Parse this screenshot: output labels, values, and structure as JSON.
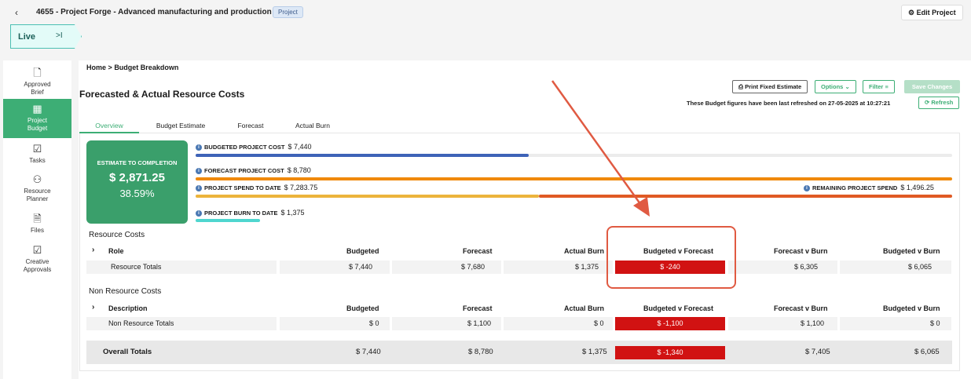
{
  "header": {
    "title": "4655 - Project Forge - Advanced manufacturing and production",
    "badge": "Project",
    "edit_button": "Edit Project",
    "live_label": "Live",
    "live_icon": ">I"
  },
  "sidebar": {
    "items": [
      {
        "label1": "Approved",
        "label2": "Brief",
        "icon": "document-icon",
        "active": false
      },
      {
        "label1": "Project",
        "label2": "Budget",
        "icon": "calculator-icon",
        "active": true
      },
      {
        "label1": "Tasks",
        "label2": "",
        "icon": "calendar-check-icon",
        "active": false
      },
      {
        "label1": "Resource",
        "label2": "Planner",
        "icon": "resource-planner-icon",
        "active": false
      },
      {
        "label1": "Files",
        "label2": "",
        "icon": "file-icon",
        "active": false
      },
      {
        "label1": "Creative",
        "label2": "Approvals",
        "icon": "approvals-icon",
        "active": false
      }
    ]
  },
  "breadcrumb": {
    "home": "Home",
    "separator": ">",
    "current": "Budget Breakdown"
  },
  "page_title": "Forecasted & Actual Resource Costs",
  "toolbar": {
    "print": "Print Fixed Estimate",
    "options": "Options",
    "filter": "Filter",
    "save": "Save Changes",
    "refresh_note": "These Budget figures have been last refreshed on 27-05-2025 at 10:27:21",
    "refresh": "Refresh"
  },
  "tabs": [
    "Overview",
    "Budget Estimate",
    "Forecast",
    "Actual Burn"
  ],
  "summary": {
    "card_label": "ESTIMATE TO COMPLETION",
    "card_amount": "$ 2,871.25",
    "card_percent": "38.59%",
    "budgeted_label": "BUDGETED PROJECT COST",
    "budgeted_value": "$ 7,440",
    "forecast_label": "FORECAST PROJECT COST",
    "forecast_value": "$ 8,780",
    "spend_label": "PROJECT SPEND TO DATE",
    "spend_value": "$ 7,283.75",
    "remaining_label": "REMAINING PROJECT SPEND",
    "remaining_value": "$ 1,496.25",
    "burn_label": "PROJECT BURN TO DATE",
    "burn_value": "$ 1,375",
    "colors": {
      "budgeted": "#3e63b8",
      "forecast": "#f0890a",
      "spend": "#ecb43c",
      "remaining": "#e05a24",
      "burn": "#4fd6cf"
    },
    "fractions": {
      "budgeted": 0.847,
      "forecast": 1.0,
      "spend": 0.83,
      "burn": 0.157
    }
  },
  "resource_costs": {
    "title": "Resource Costs",
    "headers": {
      "first": "Role",
      "budgeted": "Budgeted",
      "forecast": "Forecast",
      "actual": "Actual Burn",
      "bvf": "Budgeted v Forecast",
      "fvb": "Forecast v Burn",
      "bvb": "Budgeted v Burn"
    },
    "row": {
      "name": "Resource Totals",
      "budgeted": "$ 7,440",
      "forecast": "$ 7,680",
      "actual": "$ 1,375",
      "bvf": "$ -240",
      "fvb": "$ 6,305",
      "bvb": "$ 6,065"
    }
  },
  "non_resource_costs": {
    "title": "Non Resource Costs",
    "headers": {
      "first": "Description",
      "budgeted": "Budgeted",
      "forecast": "Forecast",
      "actual": "Actual Burn",
      "bvf": "Budgeted v Forecast",
      "fvb": "Forecast v Burn",
      "bvb": "Budgeted v Burn"
    },
    "row": {
      "name": "Non Resource Totals",
      "budgeted": "$ 0",
      "forecast": "$ 1,100",
      "actual": "$ 0",
      "bvf": "$ -1,100",
      "fvb": "$ 1,100",
      "bvb": "$ 0"
    }
  },
  "overall": {
    "name": "Overall Totals",
    "budgeted": "$ 7,440",
    "forecast": "$ 8,780",
    "actual": "$ 1,375",
    "bvf": "$ -1,340",
    "fvb": "$ 7,405",
    "bvb": "$ 6,065"
  }
}
